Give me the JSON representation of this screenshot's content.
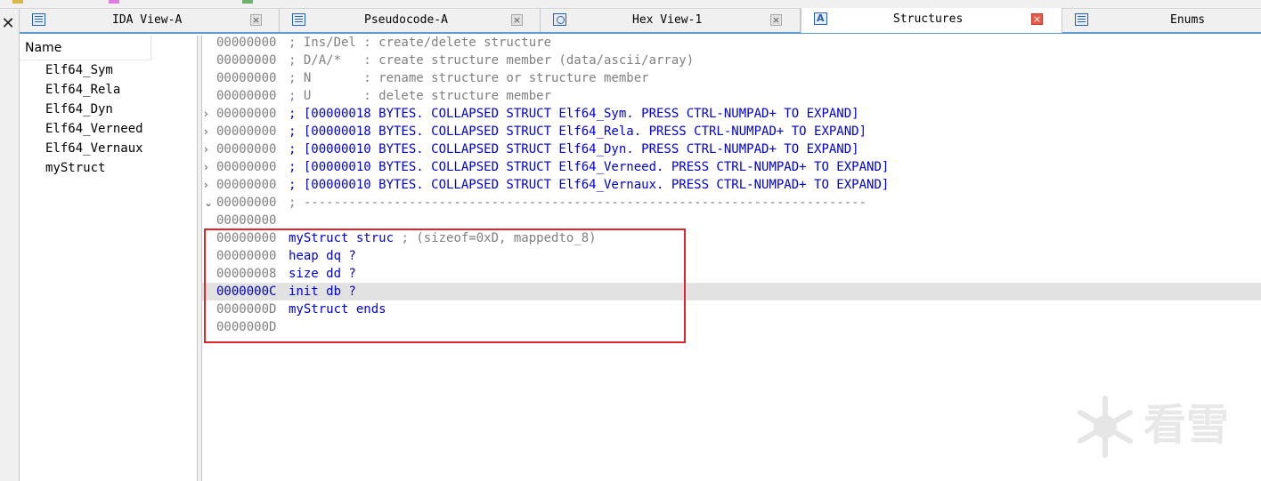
{
  "tabs": [
    {
      "label": "IDA View-A",
      "icon": "view-icon",
      "active": false
    },
    {
      "label": "Pseudocode-A",
      "icon": "pseudocode-icon",
      "active": false
    },
    {
      "label": "Hex View-1",
      "icon": "hex-icon",
      "active": false
    },
    {
      "label": "Structures",
      "icon": "structures-icon",
      "active": true
    },
    {
      "label": "Enums",
      "icon": "enums-icon",
      "active": false
    }
  ],
  "close_glyph": "×",
  "side_close_glyph": "✕",
  "name_panel": {
    "header": "Name",
    "items": [
      "Elf64_Sym",
      "Elf64_Rela",
      "Elf64_Dyn",
      "Elf64_Verneed",
      "Elf64_Vernaux",
      "myStruct"
    ]
  },
  "code_lines": [
    {
      "gutter": "",
      "addr": "00000000",
      "addr_blue": false,
      "text": "; Ins/Del : create/delete structure",
      "color": "gray"
    },
    {
      "gutter": "",
      "addr": "00000000",
      "addr_blue": false,
      "text": "; D/A/*   : create structure member (data/ascii/array)",
      "color": "gray"
    },
    {
      "gutter": "",
      "addr": "00000000",
      "addr_blue": false,
      "text": "; N       : rename structure or structure member",
      "color": "gray"
    },
    {
      "gutter": "",
      "addr": "00000000",
      "addr_blue": false,
      "text": "; U       : delete structure member",
      "color": "gray"
    },
    {
      "gutter": "›",
      "addr": "00000000",
      "addr_blue": false,
      "text": "; [00000018 BYTES. COLLAPSED STRUCT Elf64_Sym. PRESS CTRL-NUMPAD+ TO EXPAND]",
      "color": "blue"
    },
    {
      "gutter": "›",
      "addr": "00000000",
      "addr_blue": false,
      "text": "; [00000018 BYTES. COLLAPSED STRUCT Elf64_Rela. PRESS CTRL-NUMPAD+ TO EXPAND]",
      "color": "blue"
    },
    {
      "gutter": "›",
      "addr": "00000000",
      "addr_blue": false,
      "text": "; [00000010 BYTES. COLLAPSED STRUCT Elf64_Dyn. PRESS CTRL-NUMPAD+ TO EXPAND]",
      "color": "blue"
    },
    {
      "gutter": "›",
      "addr": "00000000",
      "addr_blue": false,
      "text": "; [00000010 BYTES. COLLAPSED STRUCT Elf64_Verneed. PRESS CTRL-NUMPAD+ TO EXPAND]",
      "color": "blue"
    },
    {
      "gutter": "›",
      "addr": "00000000",
      "addr_blue": false,
      "text": "; [00000010 BYTES. COLLAPSED STRUCT Elf64_Vernaux. PRESS CTRL-NUMPAD+ TO EXPAND]",
      "color": "blue"
    },
    {
      "gutter": "⌄",
      "addr": "00000000",
      "addr_blue": false,
      "text": "; ---------------------------------------------------------------------------",
      "color": "gray"
    },
    {
      "gutter": "",
      "addr": "00000000",
      "addr_blue": false,
      "text": "",
      "color": "gray"
    },
    {
      "gutter": "",
      "addr": "00000000",
      "addr_blue": false,
      "text": "myStruct struc",
      "text2": " ; (sizeof=0xD, mappedto_8)",
      "color": "blue",
      "color2": "gray"
    },
    {
      "gutter": "",
      "addr": "00000000",
      "addr_blue": false,
      "text": "heap dq ?",
      "color": "blue"
    },
    {
      "gutter": "",
      "addr": "00000008",
      "addr_blue": false,
      "text": "size dd ?",
      "color": "blue"
    },
    {
      "gutter": "",
      "addr": "0000000C",
      "addr_blue": true,
      "text": "init db ?",
      "color": "blue",
      "highlight": true
    },
    {
      "gutter": "",
      "addr": "0000000D",
      "addr_blue": false,
      "text": "myStruct ends",
      "color": "blue"
    },
    {
      "gutter": "",
      "addr": "0000000D",
      "addr_blue": false,
      "text": "",
      "color": "gray"
    }
  ],
  "watermark": {
    "text": "看雪",
    "icon": "snowflake-icon"
  }
}
